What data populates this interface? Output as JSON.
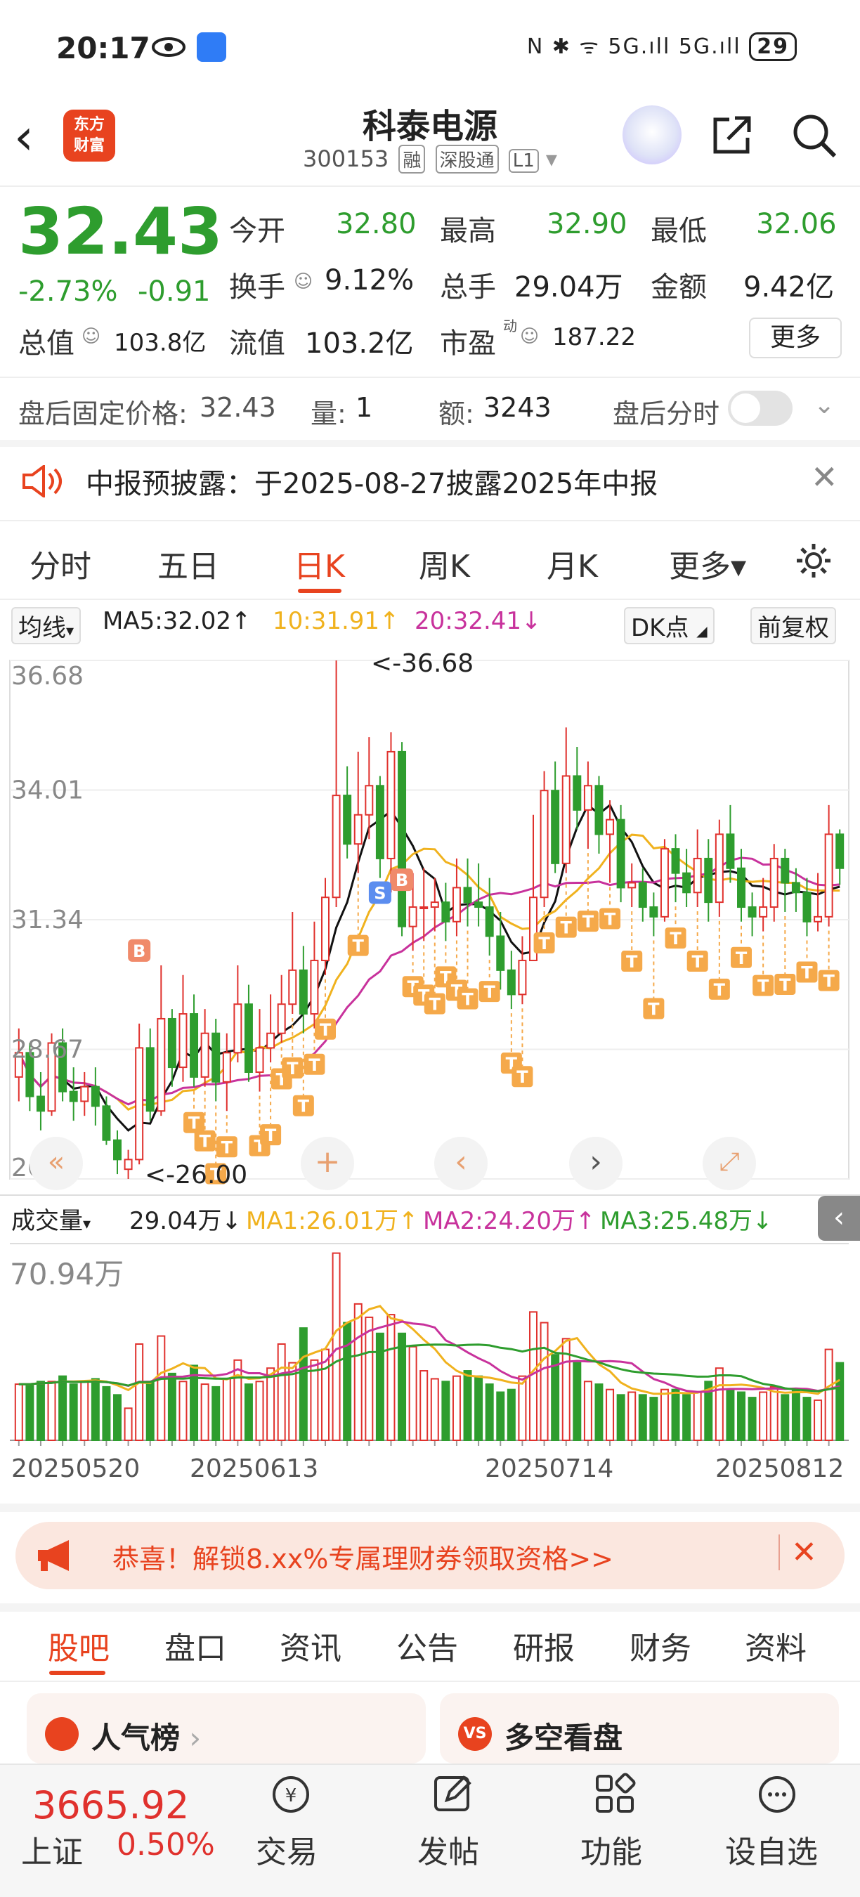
{
  "status_bar": {
    "time": "20:17",
    "network": "N ✱ ᯤ 5G.ıll 5G.ıll",
    "battery": "29"
  },
  "header": {
    "logo_text": "东方\n财富",
    "title": "科泰电源",
    "code": "300153",
    "tags": [
      "融",
      "深股通",
      "L1"
    ]
  },
  "quote": {
    "price": "32.43",
    "change_pct": "-2.73%",
    "change": "-0.91",
    "open_label": "今开",
    "open": "32.80",
    "high_label": "最高",
    "high": "32.90",
    "low_label": "最低",
    "low": "32.06",
    "turnover_label": "换手",
    "turnover": "9.12%",
    "volume_label": "总手",
    "volume": "29.04万",
    "amount_label": "金额",
    "amount": "9.42亿",
    "mcap_label": "总值",
    "mcap": "103.8亿",
    "float_label": "流值",
    "float": "103.2亿",
    "pe_label": "市盈",
    "pe_sup": "动",
    "pe": "187.22",
    "more": "更多"
  },
  "after_hours": {
    "price_label": "盘后固定价格:",
    "price": "32.43",
    "vol_label": "量:",
    "vol": "1",
    "amt_label": "额:",
    "amt": "3243",
    "time_label": "盘后分时"
  },
  "notice": {
    "text": "中报预披露：于2025-08-27披露2025年中报"
  },
  "period_tabs": [
    "分时",
    "五日",
    "日K",
    "周K",
    "月K",
    "更多▾"
  ],
  "chart_controls": {
    "ma_selector": "均线",
    "ma5": "MA5:32.02↑",
    "ma10": "10:31.91↑",
    "ma20": "20:32.41↓",
    "dk": "DK点",
    "adjust": "前复权",
    "vol_selector": "成交量",
    "vol_now": "29.04万↓",
    "vma1": "MA1:26.01万↑",
    "vma2": "MA2:24.20万↑",
    "vma3": "MA3:25.48万↓",
    "vol_max": "70.94万",
    "high_marker": "<-36.68",
    "low_marker": "<-26.00",
    "colors": {
      "up": "#e0312d",
      "down": "#2e9d2e",
      "ma5": "#111111",
      "ma10": "#f0b21e",
      "ma20": "#c8329c",
      "t": "#f5a94a"
    }
  },
  "chart_data": {
    "type": "candlestick",
    "y_ticks": [
      "36.68",
      "34.01",
      "31.34",
      "28.67",
      "26.00"
    ],
    "ylim": [
      26.0,
      36.68
    ],
    "x_ticks": [
      "20250520",
      "20250613",
      "20250714",
      "20250812"
    ],
    "candles": [
      [
        28.1,
        28.6,
        29.1,
        27.6
      ],
      [
        28.6,
        27.7,
        28.8,
        27.4
      ],
      [
        27.7,
        27.4,
        28.2,
        27.0
      ],
      [
        27.4,
        28.8,
        29.0,
        27.3
      ],
      [
        28.8,
        27.8,
        29.1,
        27.6
      ],
      [
        27.8,
        27.6,
        28.3,
        27.2
      ],
      [
        27.6,
        27.9,
        28.2,
        27.3
      ],
      [
        27.9,
        27.5,
        28.3,
        27.1
      ],
      [
        27.5,
        26.8,
        27.7,
        26.7
      ],
      [
        26.8,
        26.4,
        27.0,
        26.1
      ],
      [
        26.2,
        26.4,
        26.6,
        26.0
      ],
      [
        26.4,
        28.7,
        29.2,
        26.3
      ],
      [
        28.7,
        27.4,
        29.1,
        27.2
      ],
      [
        27.4,
        29.3,
        30.4,
        27.3
      ],
      [
        29.3,
        28.3,
        29.5,
        27.9
      ],
      [
        28.3,
        29.4,
        30.2,
        28.0
      ],
      [
        29.4,
        28.1,
        29.8,
        27.9
      ],
      [
        28.1,
        29.0,
        29.5,
        27.9
      ],
      [
        29.0,
        28.0,
        29.3,
        27.6
      ],
      [
        28.0,
        28.6,
        29.0,
        27.4
      ],
      [
        28.6,
        29.6,
        30.4,
        28.4
      ],
      [
        29.6,
        28.2,
        30.0,
        28.0
      ],
      [
        28.2,
        28.7,
        29.5,
        27.8
      ],
      [
        28.7,
        29.0,
        29.8,
        28.4
      ],
      [
        29.0,
        29.6,
        30.2,
        28.8
      ],
      [
        29.6,
        30.3,
        31.5,
        29.4
      ],
      [
        30.3,
        29.4,
        30.8,
        29.0
      ],
      [
        29.4,
        30.5,
        31.3,
        29.1
      ],
      [
        30.5,
        31.8,
        32.2,
        30.2
      ],
      [
        31.8,
        33.9,
        36.68,
        31.6
      ],
      [
        33.9,
        32.9,
        34.5,
        32.6
      ],
      [
        32.9,
        33.5,
        34.8,
        32.3
      ],
      [
        33.5,
        34.1,
        35.1,
        33.0
      ],
      [
        34.1,
        32.6,
        34.3,
        32.2
      ],
      [
        32.6,
        34.8,
        35.2,
        31.9
      ],
      [
        34.8,
        31.2,
        35.0,
        31.0
      ],
      [
        31.2,
        31.6,
        32.3,
        30.7
      ],
      [
        31.6,
        31.6,
        32.4,
        30.9
      ],
      [
        31.6,
        31.7,
        32.2,
        31.1
      ],
      [
        31.7,
        31.3,
        32.1,
        30.9
      ],
      [
        31.3,
        32.0,
        32.6,
        31.0
      ],
      [
        32.0,
        31.7,
        32.6,
        31.2
      ],
      [
        31.7,
        31.6,
        32.5,
        31.2
      ],
      [
        31.6,
        31.0,
        32.2,
        30.6
      ],
      [
        31.0,
        30.3,
        31.5,
        29.9
      ],
      [
        30.3,
        29.8,
        30.7,
        29.5
      ],
      [
        29.8,
        30.5,
        31.0,
        29.6
      ],
      [
        30.5,
        31.8,
        33.5,
        30.5
      ],
      [
        31.8,
        34.0,
        34.4,
        31.6
      ],
      [
        34.0,
        32.5,
        34.6,
        32.3
      ],
      [
        32.5,
        34.3,
        35.3,
        32.3
      ],
      [
        34.3,
        33.6,
        34.9,
        33.2
      ],
      [
        33.6,
        34.1,
        34.6,
        32.8
      ],
      [
        34.1,
        33.1,
        34.3,
        32.7
      ],
      [
        33.1,
        33.4,
        33.8,
        32.1
      ],
      [
        33.4,
        32.0,
        33.7,
        31.7
      ],
      [
        32.0,
        32.1,
        32.5,
        31.6
      ],
      [
        32.1,
        31.6,
        32.4,
        31.3
      ],
      [
        31.6,
        31.4,
        31.9,
        31.0
      ],
      [
        31.4,
        32.8,
        33.0,
        31.3
      ],
      [
        32.8,
        32.3,
        33.1,
        31.7
      ],
      [
        32.3,
        31.9,
        32.8,
        31.6
      ],
      [
        31.9,
        32.6,
        33.2,
        31.6
      ],
      [
        32.6,
        31.7,
        33.0,
        31.3
      ],
      [
        31.7,
        33.1,
        33.4,
        31.4
      ],
      [
        33.1,
        32.4,
        33.7,
        32.1
      ],
      [
        32.4,
        31.6,
        32.8,
        31.3
      ],
      [
        31.6,
        31.4,
        31.9,
        31.0
      ],
      [
        31.4,
        31.6,
        32.2,
        31.1
      ],
      [
        31.6,
        32.6,
        32.9,
        31.3
      ],
      [
        32.6,
        32.1,
        32.8,
        31.5
      ],
      [
        32.1,
        31.9,
        32.4,
        31.5
      ],
      [
        31.9,
        31.3,
        32.2,
        31.0
      ],
      [
        31.3,
        31.4,
        32.3,
        31.1
      ],
      [
        31.4,
        33.1,
        33.7,
        31.2
      ],
      [
        33.1,
        32.4,
        33.2,
        32.06
      ]
    ],
    "volumes_wan": [
      21,
      21,
      22,
      22,
      24,
      21,
      22,
      23,
      20,
      17,
      12,
      36,
      22,
      39,
      25,
      22,
      28,
      21,
      20,
      23,
      30,
      21,
      22,
      27,
      36,
      29,
      42,
      30,
      34,
      70,
      44,
      51,
      46,
      40,
      47,
      40,
      35,
      26,
      23,
      22,
      24,
      26,
      24,
      21,
      18,
      19,
      24,
      48,
      44,
      32,
      38,
      29,
      22,
      21,
      19,
      17,
      18,
      17,
      16,
      19,
      19,
      17,
      18,
      22,
      27,
      19,
      18,
      16,
      18,
      20,
      17,
      19,
      16,
      15,
      34,
      29
    ]
  },
  "promo": {
    "text": "恭喜！解锁8.xx%专属理财券领取资格>>"
  },
  "bottom_tabs": [
    "股吧",
    "盘口",
    "资讯",
    "公告",
    "研报",
    "财务",
    "资料"
  ],
  "cards": [
    {
      "title": "人气榜",
      "icon": "bar-chart-icon"
    },
    {
      "title": "多空看盘",
      "icon": "vs-icon"
    }
  ],
  "bottom_nav": {
    "index_value": "3665.92",
    "index_name": "上证",
    "index_change": "0.50%",
    "items": [
      "交易",
      "发帖",
      "功能",
      "设自选"
    ]
  }
}
